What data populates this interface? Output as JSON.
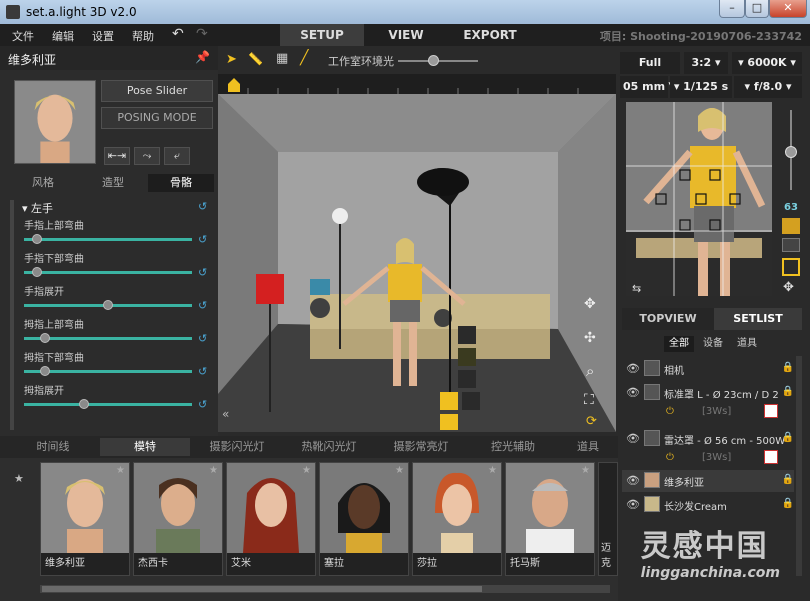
{
  "window": {
    "title": "set.a.light 3D v2.0"
  },
  "menu": [
    "文件",
    "编辑",
    "设置",
    "帮助"
  ],
  "main_tabs": [
    {
      "label": "SETUP",
      "active": true
    },
    {
      "label": "VIEW",
      "active": false
    },
    {
      "label": "EXPORT",
      "active": false
    }
  ],
  "project": "项目: Shooting-20190706-233742",
  "left": {
    "model_name": "维多利亚",
    "pose_slider_label": "Pose Slider",
    "posing_mode_label": "POSING MODE",
    "subtabs": [
      "风格",
      "造型",
      "骨骼"
    ],
    "section_title": "左手",
    "sliders": [
      {
        "label": "手指上部弯曲",
        "value": 0.05
      },
      {
        "label": "手指下部弯曲",
        "value": 0.05
      },
      {
        "label": "手指展开",
        "value": 0.5
      },
      {
        "label": "拇指上部弯曲",
        "value": 0.1
      },
      {
        "label": "拇指下部弯曲",
        "value": 0.1
      },
      {
        "label": "拇指展开",
        "value": 0.35
      }
    ]
  },
  "toolbar": {
    "ambient_label": "工作室环境光"
  },
  "bottom_tabs": [
    "时间线",
    "模特",
    "摄影闪光灯",
    "热靴闪光灯",
    "摄影常亮灯",
    "控光辅助",
    "道具"
  ],
  "models": [
    {
      "name": "维多利亚"
    },
    {
      "name": "杰西卡"
    },
    {
      "name": "艾米"
    },
    {
      "name": "塞拉"
    },
    {
      "name": "莎拉"
    },
    {
      "name": "托马斯"
    },
    {
      "name": "迈克"
    }
  ],
  "camera": {
    "format": "Full Frame",
    "ratio": "3:2",
    "kelvin": "6000K",
    "focal": "05 mm",
    "shutter": "1/125 s",
    "aperture": "f/8.0",
    "zoom_value": "63"
  },
  "right_tabs": [
    {
      "label": "TOPVIEW",
      "active": false
    },
    {
      "label": "SETLIST",
      "active": true
    }
  ],
  "filters": [
    {
      "label": "全部",
      "active": true
    },
    {
      "label": "设备",
      "active": false
    },
    {
      "label": "道具",
      "active": false
    }
  ],
  "setlist": [
    {
      "label": "相机",
      "sub": ""
    },
    {
      "label": "标准罩 L - Ø 23cm / D 2",
      "sub": "[3Ws]"
    },
    {
      "label": "雷达罩 - Ø 56 cm - 500W",
      "sub": "[3Ws]"
    },
    {
      "label": "维多利亚",
      "sub": ""
    },
    {
      "label": "长沙发Cream",
      "sub": ""
    }
  ],
  "watermark": {
    "cn": "灵感中国",
    "url": "lingganchina.com"
  }
}
